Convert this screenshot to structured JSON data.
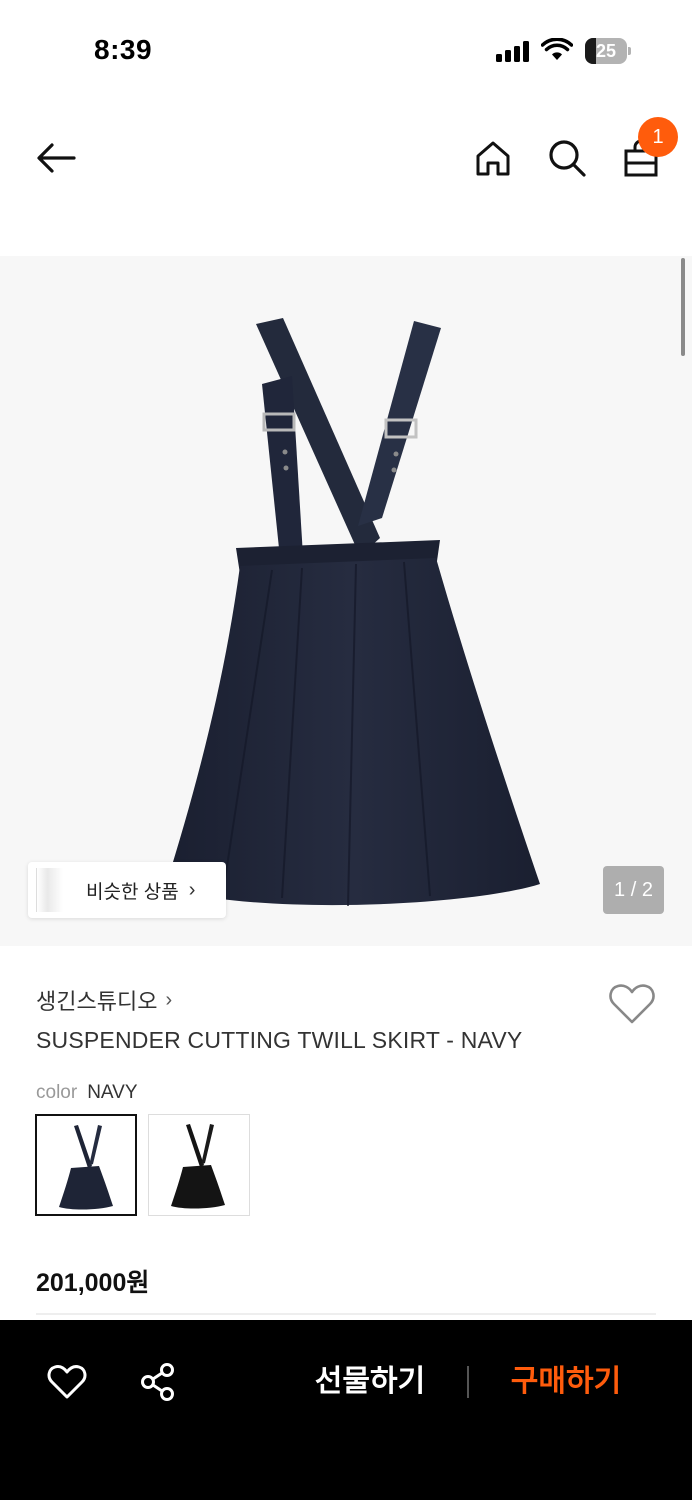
{
  "status_bar": {
    "time": "8:39",
    "battery_level": "25",
    "battery_percent": 25
  },
  "nav": {
    "back_icon": "arrow-left-icon",
    "home_icon": "home-icon",
    "search_icon": "search-icon",
    "cart_icon": "shopping-bag-icon",
    "cart_badge": "1"
  },
  "gallery": {
    "similar_label": "비슷한 상품",
    "similar_chevron": "›",
    "page_counter": "1 / 2"
  },
  "product": {
    "brand": "생긴스튜디오",
    "brand_chevron": "›",
    "title": "SUSPENDER CUTTING TWILL SKIRT - NAVY",
    "color_label": "color",
    "color_value": "NAVY",
    "swatches": [
      "navy",
      "black"
    ],
    "price": "201,000원"
  },
  "bottom_bar": {
    "heart_icon": "heart-outline-icon",
    "share_icon": "share-icon",
    "gift_label": "선물하기",
    "buy_label": "구매하기"
  },
  "colors": {
    "accent": "#ff5c0c",
    "bar_background": "#000000",
    "navy": "#1e2436",
    "black": "#141414"
  }
}
